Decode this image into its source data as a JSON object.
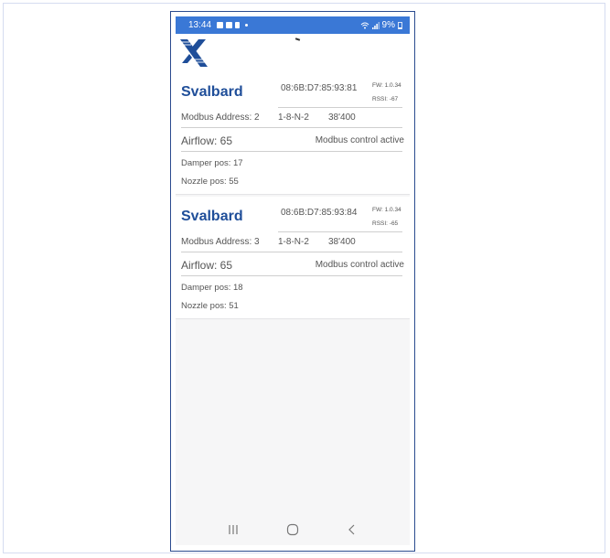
{
  "status_bar": {
    "time": "13:44",
    "battery": "9%",
    "icons": [
      "image-icon",
      "check-icon",
      "phone-icon",
      "dot-icon",
      "wifi-icon",
      "signal-icon",
      "battery-icon"
    ]
  },
  "app_bar": {
    "logo": "x-logo-icon"
  },
  "devices": [
    {
      "name": "Svalbard",
      "mac": "08:6B:D7:85:93:81",
      "fw": "FW: 1.0.34",
      "rssi": "RSSI: -67",
      "modbus_address": "Modbus Address: 2",
      "parity": "1-8-N-2",
      "baud": "38'400",
      "airflow": "Airflow: 65",
      "modbus_status": "Modbus control active",
      "damper": "Damper pos: 17",
      "nozzle": "Nozzle pos: 55"
    },
    {
      "name": "Svalbard",
      "mac": "08:6B:D7:85:93:84",
      "fw": "FW: 1.0.34",
      "rssi": "RSSI: -65",
      "modbus_address": "Modbus Address: 3",
      "parity": "1-8-N-2",
      "baud": "38'400",
      "airflow": "Airflow: 65",
      "modbus_status": "Modbus control active",
      "damper": "Damper pos: 18",
      "nozzle": "Nozzle pos: 51"
    }
  ],
  "nav_bar": {
    "buttons": [
      "recent-apps-icon",
      "home-icon",
      "back-icon"
    ]
  },
  "colors": {
    "status_bar": "#3a78d6",
    "device_name": "#1f4e99",
    "frame_border": "#2b4b8f",
    "background": "#f6f6f7"
  }
}
